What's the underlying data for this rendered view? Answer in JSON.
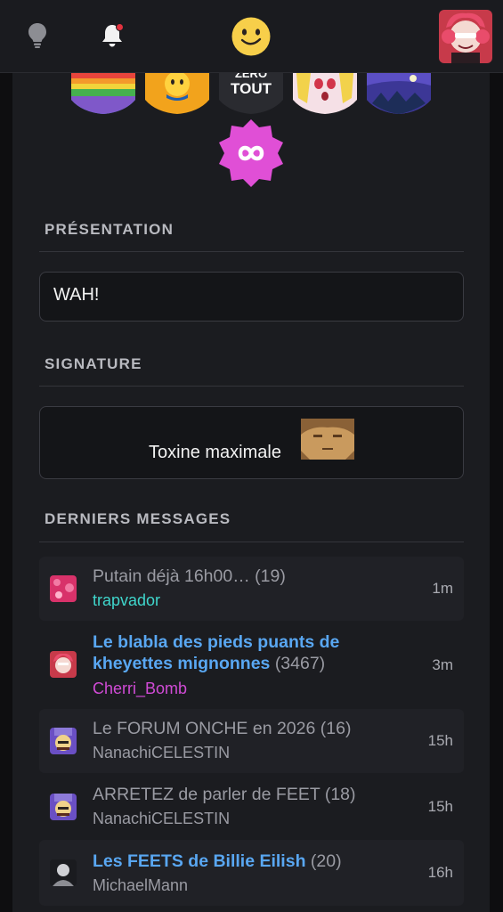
{
  "topbar": {
    "icons": [
      "lightbulb-icon",
      "bell-icon",
      "smiley-icon",
      "user-avatar"
    ]
  },
  "profile": {
    "badges": [
      "rainbow-badge",
      "yellow-face-badge",
      "zero-tout-badge",
      "anime-girl-badge",
      "night-sky-badge",
      "infinity-badge"
    ],
    "badge_text": {
      "zero_tout": "ZERO TOUT"
    },
    "presentation_heading": "PRÉSENTATION",
    "presentation_text": "WAH!",
    "signature_heading": "SIGNATURE",
    "signature_text": "Toxine maximale",
    "messages_heading": "DERNIERS MESSAGES"
  },
  "messages": [
    {
      "title": "Putain déjà 16h00…",
      "count": "(19)",
      "author": "trapvador",
      "author_color": "#3fd6cc",
      "time": "1m",
      "link": false
    },
    {
      "title": "Le blabla des pieds puants de",
      "title2": "kheyettes mignonnes",
      "count": "(3467)",
      "author": "Cherri_Bomb",
      "author_color": "#d14bd6",
      "time": "3m",
      "link": true
    },
    {
      "title": "Le FORUM ONCHE en 2026",
      "count": "(16)",
      "author": "NanachiCELESTIN",
      "author_color": "#9a9ba3",
      "time": "15h",
      "link": false
    },
    {
      "title": "ARRETEZ de parler de FEET",
      "count": "(18)",
      "author": "NanachiCELESTIN",
      "author_color": "#9a9ba3",
      "time": "15h",
      "link": false
    },
    {
      "title": "Les FEETS de Billie Eilish",
      "count": "(20)",
      "author": "MichaelMann",
      "author_color": "#9a9ba3",
      "time": "16h",
      "link": true
    }
  ],
  "colors": {
    "link": "#59a7f2",
    "accent_pink": "#e04fd6",
    "notification_dot": "#e2323f"
  }
}
